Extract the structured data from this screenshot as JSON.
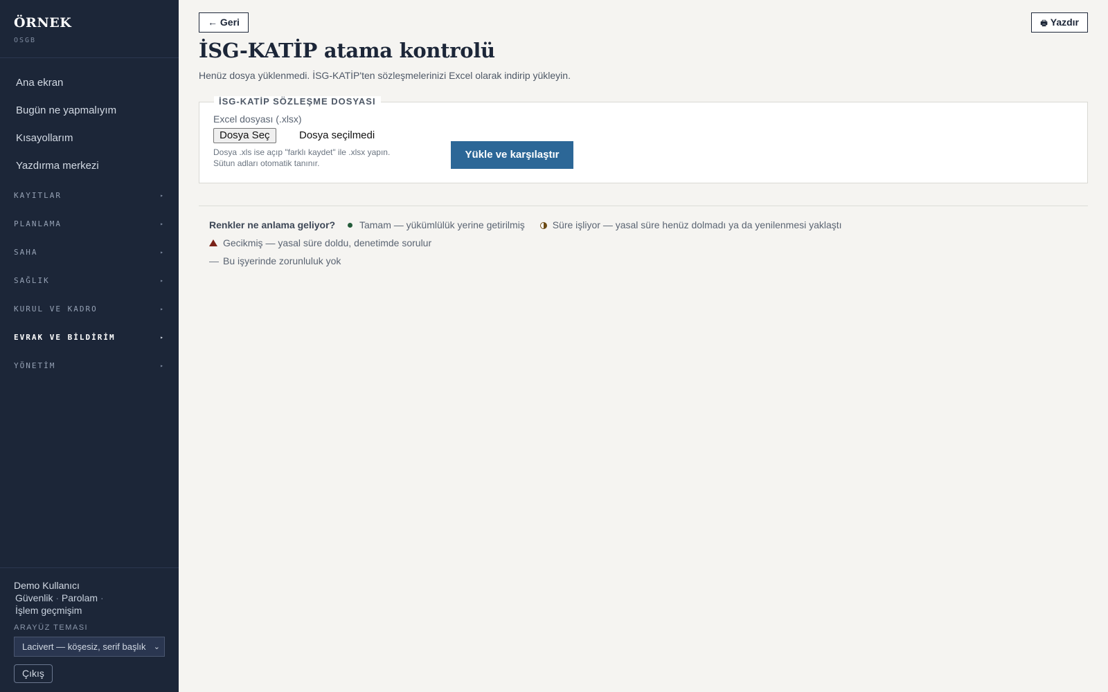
{
  "brand": {
    "name": "ÖRNEK",
    "sub": "OSGB"
  },
  "nav": {
    "links": [
      "Ana ekran",
      "Bugün ne yapmalıyım",
      "Kısayollarım",
      "Yazdırma merkezi"
    ],
    "groups": [
      {
        "label": "KAYITLAR",
        "active": false
      },
      {
        "label": "PLANLAMA",
        "active": false
      },
      {
        "label": "SAHA",
        "active": false
      },
      {
        "label": "SAĞLIK",
        "active": false
      },
      {
        "label": "KURUL VE KADRO",
        "active": false
      },
      {
        "label": "EVRAK VE BİLDİRİM",
        "active": true
      },
      {
        "label": "YÖNETİM",
        "active": false
      }
    ],
    "arrow": "▸"
  },
  "user": {
    "name": "Demo Kullanıcı",
    "links": [
      "Güvenlik",
      "Parolam",
      "İşlem geçmişim"
    ],
    "separator": "·"
  },
  "theme": {
    "label": "ARAYÜZ TEMASI",
    "selected": "Lacivert — köşesiz, serif başlık"
  },
  "logout_label": "Çıkış",
  "toolbar": {
    "back_label": "← Geri",
    "print_label": "Yazdır"
  },
  "page": {
    "title": "İSG-KATİP atama kontrolü",
    "subtitle": "Henüz dosya yüklenmedi. İSG-KATİP'ten sözleşmelerinizi Excel olarak indirip yükleyin."
  },
  "upload": {
    "legend": "İSG-KATİP SÖZLEŞME DOSYASI",
    "field_label": "Excel dosyası (.xlsx)",
    "file_button": "Dosya Seç",
    "file_status": "Dosya seçilmedi",
    "help_line1": "Dosya .xls ise açıp \"farklı kaydet\" ile .xlsx yapın.",
    "help_line2": "Sütun adları otomatik tanınır.",
    "submit_label": "Yükle ve karşılaştır"
  },
  "legend": {
    "title": "Renkler ne anlama geliyor?",
    "ok": "Tamam — yükümlülük yerine getirilmiş",
    "pending": "Süre işliyor — yasal süre henüz dolmadı ya da yenilenmesi yaklaştı",
    "late": "Gecikmiş — yasal süre doldu, denetimde sorulur",
    "none": "Bu işyerinde zorunluluk yok"
  },
  "colors": {
    "sidebar_bg": "#1c2638",
    "primary_button": "#2c6797",
    "ok": "#245c3a",
    "pending": "#6b4a14",
    "late": "#7a2218"
  }
}
